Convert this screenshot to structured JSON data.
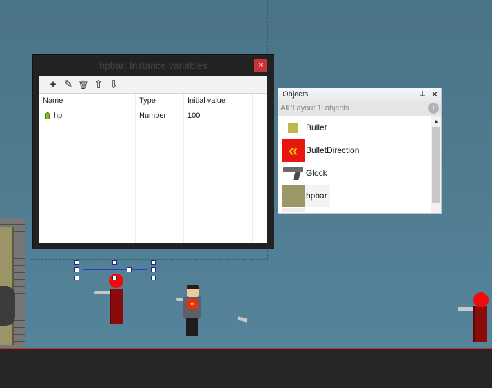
{
  "instance_dialog": {
    "title": "hpbar: Instance variables",
    "close_label": "×",
    "toolbar": {
      "add": "+",
      "edit": "✎",
      "delete": "🗑",
      "move_up": "⇧",
      "move_down": "⇩"
    },
    "columns": [
      "Name",
      "Type",
      "Initial value"
    ],
    "rows": [
      {
        "name": "hp",
        "type": "Number",
        "value": "100"
      }
    ]
  },
  "objects_panel": {
    "title": "Objects",
    "pin_icon": "pin-icon",
    "close_label": "✕",
    "filter_text": "All 'Layout 1' objects",
    "up_label": "↑",
    "items": [
      {
        "label": "Bullet",
        "icon_color": "#bdb84a"
      },
      {
        "label": "BulletDirection",
        "icon_color": "#e8160f"
      },
      {
        "label": "Glock",
        "icon_color": "#6a6a6a"
      },
      {
        "label": "hpbar",
        "icon_color": "#9c9668"
      }
    ]
  },
  "colors": {
    "background": "#4f7b91",
    "ground": "#262626",
    "enemy": "#8a0b0b",
    "selection": "#2a3ad0"
  }
}
